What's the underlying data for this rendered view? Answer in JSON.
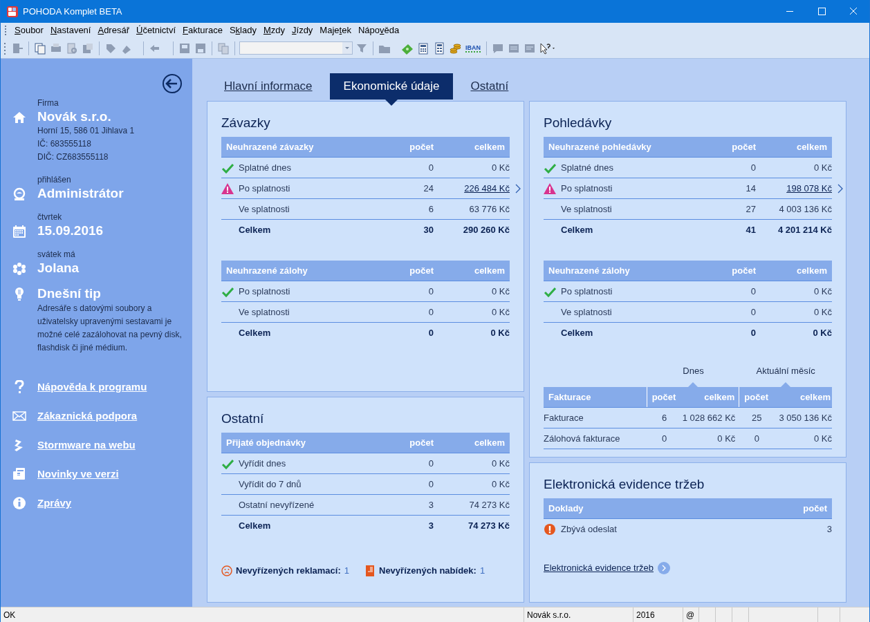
{
  "window": {
    "title": "POHODA Komplet BETA"
  },
  "menu": [
    {
      "key": "S",
      "end": "oubor"
    },
    {
      "key": "N",
      "end": "astavení"
    },
    {
      "key": "A",
      "end": "dresář"
    },
    {
      "key": "Ú",
      "end": "četnictví"
    },
    {
      "key": "F",
      "end": "akturace"
    },
    {
      "start": "S",
      "key": "k",
      "end": "lady"
    },
    {
      "key": "M",
      "end": "zdy"
    },
    {
      "key": "J",
      "end": "ízdy"
    },
    {
      "start": "Maje",
      "key": "t",
      "end": "ek"
    },
    {
      "start": "Nápo",
      "key": "v",
      "end": "ěda"
    }
  ],
  "toolbar": {
    "iban_button": "IBAN"
  },
  "sidebar": {
    "sections": [
      {
        "kind": "company",
        "caption": "Firma",
        "value": "Novák s.r.o.",
        "details": [
          "Horní 15, 586 01 Jihlava 1",
          "IČ: 683555118",
          "DIČ: CZ683555118"
        ]
      },
      {
        "kind": "user",
        "caption": "přihlášen",
        "value": "Administrátor"
      },
      {
        "kind": "date",
        "caption": "čtvrtek",
        "value": "15.09.2016"
      },
      {
        "kind": "nameday",
        "caption": "svátek má",
        "value": "Jolana"
      }
    ],
    "tip": {
      "title": "Dnešní tip",
      "text": "Adresáře s datovými soubory a uživatelsky upravenými sestavami je možné celé zazálohovat na pevný disk, flashdisk či jiné médium."
    },
    "links": [
      {
        "kind": "help",
        "label": "Nápověda k programu"
      },
      {
        "kind": "mail",
        "label": "Zákaznická podpora"
      },
      {
        "kind": "web",
        "label": "Stormware na webu"
      },
      {
        "kind": "news",
        "label": "Novinky ve verzi"
      },
      {
        "kind": "info",
        "label": "Zprávy"
      }
    ]
  },
  "tabs": [
    {
      "label": "Hlavní informace",
      "selected": false
    },
    {
      "label": "Ekonomické údaje",
      "selected": true
    },
    {
      "label": "Ostatní",
      "selected": false
    }
  ],
  "zavazky": {
    "title": "Závazky",
    "tables": [
      {
        "columns": [
          "Neuhrazené závazky",
          "počet",
          "celkem"
        ],
        "rows": [
          {
            "kind": "ok",
            "label": "Splatné dnes",
            "count": "0",
            "total": "0 Kč",
            "link": false
          },
          {
            "kind": "warning",
            "label": "Po splatnosti",
            "count": "24",
            "total": "226 484 Kč",
            "link": true
          },
          {
            "kind": "plain",
            "label": "Ve splatnosti",
            "count": "6",
            "total": "63 776 Kč",
            "link": false
          },
          {
            "kind": "total",
            "label": "Celkem",
            "count": "30",
            "total": "290 260 Kč",
            "link": false
          }
        ]
      },
      {
        "columns": [
          "Neuhrazené zálohy",
          "počet",
          "celkem"
        ],
        "rows": [
          {
            "kind": "ok",
            "label": "Po splatnosti",
            "count": "0",
            "total": "0 Kč",
            "link": false
          },
          {
            "kind": "plain",
            "label": "Ve splatnosti",
            "count": "0",
            "total": "0 Kč",
            "link": false
          },
          {
            "kind": "total",
            "label": "Celkem",
            "count": "0",
            "total": "0 Kč",
            "link": false
          }
        ]
      }
    ]
  },
  "ostatni": {
    "title": "Ostatní",
    "tables": [
      {
        "columns": [
          "Přijaté objednávky",
          "počet",
          "celkem"
        ],
        "rows": [
          {
            "kind": "ok",
            "label": "Vyřídit dnes",
            "count": "0",
            "total": "0 Kč",
            "link": false
          },
          {
            "kind": "plain",
            "label": "Vyřídit do 7 dnů",
            "count": "0",
            "total": "0 Kč",
            "link": false
          },
          {
            "kind": "plain",
            "label": "Ostatní nevyřízené",
            "count": "3",
            "total": "74 273 Kč",
            "link": false
          },
          {
            "kind": "total",
            "label": "Celkem",
            "count": "3",
            "total": "74 273 Kč",
            "link": false
          }
        ]
      }
    ],
    "footer": [
      {
        "kind": "complaints",
        "label": "Nevyřízených reklamací:",
        "count": "1"
      },
      {
        "kind": "offers",
        "label": "Nevyřízených nabídek:",
        "count": "1"
      }
    ]
  },
  "pohledavky": {
    "title": "Pohledávky",
    "tables": [
      {
        "columns": [
          "Neuhrazené pohledávky",
          "počet",
          "celkem"
        ],
        "rows": [
          {
            "kind": "ok",
            "label": "Splatné dnes",
            "count": "0",
            "total": "0 Kč",
            "link": false
          },
          {
            "kind": "warning",
            "label": "Po splatnosti",
            "count": "14",
            "total": "198 078 Kč",
            "link": true
          },
          {
            "kind": "plain",
            "label": "Ve splatnosti",
            "count": "27",
            "total": "4 003 136 Kč",
            "link": false
          },
          {
            "kind": "total",
            "label": "Celkem",
            "count": "41",
            "total": "4 201 214 Kč",
            "link": false
          }
        ]
      },
      {
        "columns": [
          "Neuhrazené zálohy",
          "počet",
          "celkem"
        ],
        "rows": [
          {
            "kind": "ok",
            "label": "Po splatnosti",
            "count": "0",
            "total": "0 Kč",
            "link": false
          },
          {
            "kind": "plain",
            "label": "Ve splatnosti",
            "count": "0",
            "total": "0 Kč",
            "link": false
          },
          {
            "kind": "total",
            "label": "Celkem",
            "count": "0",
            "total": "0 Kč",
            "link": false
          }
        ]
      }
    ],
    "invoicing": {
      "groups": [
        "Dnes",
        "Aktuální měsíc"
      ],
      "columns": [
        "Fakturace",
        "počet",
        "celkem",
        "počet",
        "celkem"
      ],
      "rows": [
        {
          "label": "Fakturace",
          "today_count": "6",
          "today_total": "1 028 662 Kč",
          "month_count": "25",
          "month_total": "3 050 136 Kč"
        },
        {
          "label": "Zálohová fakturace",
          "today_count": "0",
          "today_total": "0 Kč",
          "month_count": "0",
          "month_total": "0 Kč"
        }
      ]
    }
  },
  "eet": {
    "title": "Elektronická evidence tržeb",
    "columns": [
      "Doklady",
      "počet"
    ],
    "rows": [
      {
        "kind": "error",
        "label": "Zbývá odeslat",
        "count": "3"
      }
    ],
    "link": "Elektronická evidence tržeb"
  },
  "status_bar": [
    "OK",
    "Novák s.r.o.",
    "2016",
    "@"
  ]
}
